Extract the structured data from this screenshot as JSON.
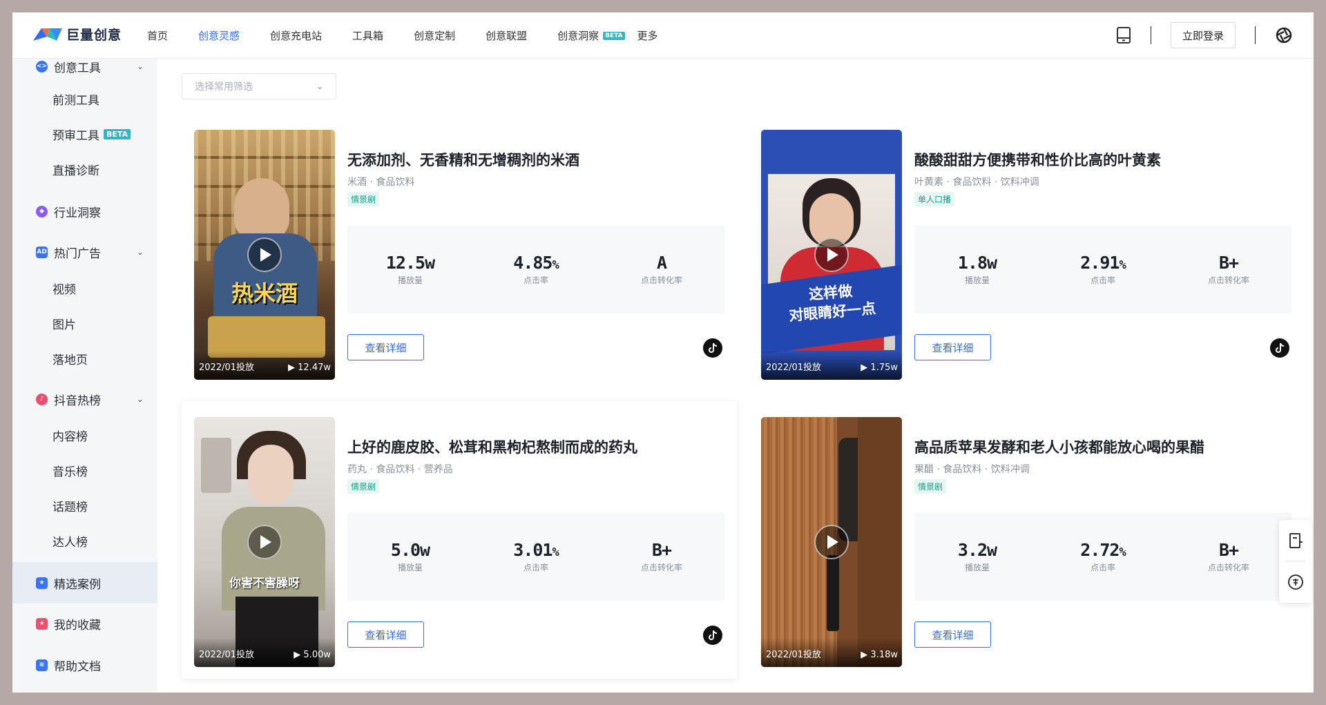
{
  "brand": {
    "name": "巨量创意"
  },
  "nav": {
    "items": [
      {
        "label": "首页"
      },
      {
        "label": "创意灵感",
        "active": true
      },
      {
        "label": "创意充电站"
      },
      {
        "label": "工具箱"
      },
      {
        "label": "创意定制"
      },
      {
        "label": "创意联盟"
      },
      {
        "label": "创意洞察",
        "badge": "BETA"
      },
      {
        "label": "更多"
      }
    ],
    "login_label": "立即登录"
  },
  "sidebar": {
    "groups": {
      "creative_tools": {
        "label": "创意工具",
        "icon": "code-icon",
        "color": "#3b74f2"
      },
      "industry": {
        "label": "行业洞察",
        "icon": "compass-icon",
        "color": "#8a5cf6"
      },
      "hot_ads": {
        "label": "热门广告",
        "icon": "ad-icon",
        "color": "#3b74f2",
        "icon_text": "AD"
      },
      "douyin": {
        "label": "抖音热榜",
        "icon": "flame-icon",
        "color": "#f04a6e"
      },
      "cases": {
        "label": "精选案例",
        "icon": "star-icon",
        "color": "#3b74f2"
      },
      "favorites": {
        "label": "我的收藏",
        "icon": "bookmark-icon",
        "color": "#f0506e"
      },
      "help": {
        "label": "帮助文档",
        "icon": "doc-icon",
        "color": "#3b74f2"
      }
    },
    "sub": {
      "pretest": "前测工具",
      "review": "预审工具",
      "review_badge": "BETA",
      "live": "直播诊断",
      "video": "视频",
      "image": "图片",
      "landing": "落地页",
      "content": "内容榜",
      "music": "音乐榜",
      "topic": "话题榜",
      "talent": "达人榜"
    }
  },
  "filter": {
    "placeholder": "选择常用筛选"
  },
  "cards": [
    {
      "title": "无添加剂、无香精和无增稠剂的米酒",
      "tags": "米酒 · 食品饮料",
      "badge": "情景剧",
      "caption": "热米酒",
      "date": "2022/01投放",
      "plays": "12.47w",
      "metrics": {
        "views": "12.5w",
        "ctr_num": "4.85",
        "ctr_unit": "%",
        "cvr": "A"
      }
    },
    {
      "title": "酸酸甜甜方便携带和性价比高的叶黄素",
      "tags": "叶黄素 · 食品饮料 · 饮料冲调",
      "badge": "单人口播",
      "caption_line1": "这样做",
      "caption_line2": "对眼睛好一点",
      "date": "2022/01投放",
      "plays": "1.75w",
      "metrics": {
        "views": "1.8w",
        "ctr_num": "2.91",
        "ctr_unit": "%",
        "cvr": "B+"
      }
    },
    {
      "title": "上好的鹿皮胶、松茸和黑枸杞熬制而成的药丸",
      "tags": "药丸 · 食品饮料 · 营养品",
      "badge": "情景剧",
      "caption": "你害不害臊呀",
      "date": "2022/01投放",
      "plays": "5.00w",
      "metrics": {
        "views": "5.0w",
        "ctr_num": "3.01",
        "ctr_unit": "%",
        "cvr": "B+"
      }
    },
    {
      "title": "高品质苹果发酵和老人小孩都能放心喝的果醋",
      "tags": "果醋 · 食品饮料 · 饮料冲调",
      "badge": "情景剧",
      "date": "2022/01投放",
      "plays": "3.18w",
      "metrics": {
        "views": "3.2w",
        "ctr_num": "2.72",
        "ctr_unit": "%",
        "cvr": "B+"
      }
    }
  ],
  "labels": {
    "views": "播放量",
    "ctr": "点击率",
    "cvr": "点击转化率",
    "detail": "查看详细"
  },
  "colors": {
    "accent": "#2f6cf6",
    "badge_green": "#16a389"
  }
}
